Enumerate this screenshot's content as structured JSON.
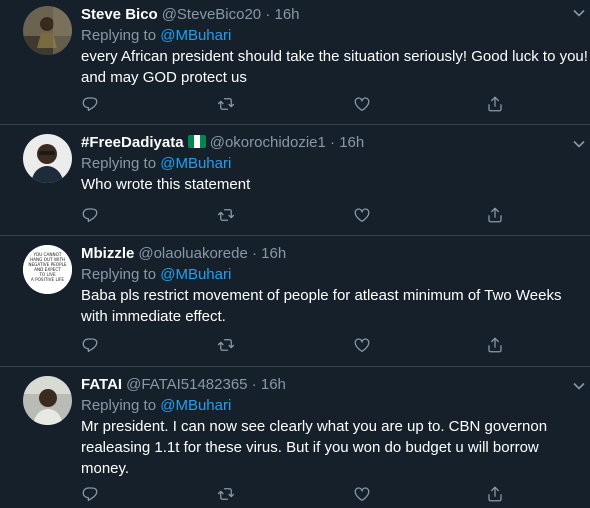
{
  "tweets": [
    {
      "name": "Steve Bico",
      "handle": "@SteveBico20",
      "dot": "·",
      "time": "16h",
      "reply_prefix": "Replying to",
      "reply_to": "@MBuhari",
      "lines": [
        "every African president should take the situation seriously! Good luck to you!",
        "and may GOD protect us"
      ]
    },
    {
      "name": "#FreeDadiyata",
      "handle": "@okorochidozie1",
      "dot": "·",
      "time": "16h",
      "reply_prefix": "Replying to",
      "reply_to": "@MBuhari",
      "lines": [
        "Who wrote this statement"
      ]
    },
    {
      "name": "Mbizzle",
      "handle": "@olaoluakorede",
      "dot": "·",
      "time": "16h",
      "reply_prefix": "Replying to",
      "reply_to": "@MBuhari",
      "lines": [
        "Baba pls restrict movement of people for atleast minimum of Two Weeks",
        "with immediate effect."
      ],
      "avatar_text": "YOU CANNOT HANG OUT WITH NEGATIVE PEOPLE AND EXPECT TO LIVE A POSITIVE LIFE"
    },
    {
      "name": "FATAI",
      "handle": "@FATAI51482365",
      "dot": "·",
      "time": "16h",
      "reply_prefix": "Replying to",
      "reply_to": "@MBuhari",
      "lines": [
        "Mr president. I can now see clearly what you are up to. CBN governon",
        "realeasing 1.1t for these virus. But if you won do budget u will borrow",
        "money."
      ]
    }
  ],
  "icons": {
    "reply": "reply-icon",
    "retweet": "retweet-icon",
    "like": "like-icon",
    "share": "share-icon",
    "more": "chevron-down-icon"
  },
  "colors": {
    "background": "#15202b",
    "divider": "#38444d",
    "secondary_text": "#8899a6",
    "link": "#1da1f2"
  }
}
